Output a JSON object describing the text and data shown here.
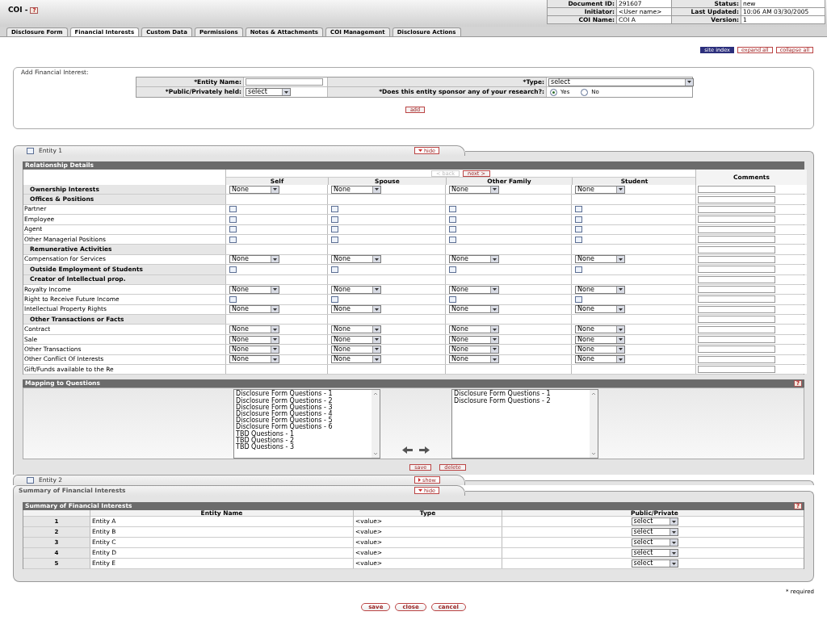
{
  "header": {
    "title": "COI -",
    "help": "?",
    "doc_info": [
      {
        "label": "Document ID:",
        "value": "291607"
      },
      {
        "label": "Status:",
        "value": "new"
      },
      {
        "label": "Initiator:",
        "value": "<User name>"
      },
      {
        "label": "Last Updated:",
        "value": "10:06 AM 03/30/2005"
      },
      {
        "label": "COI Name:",
        "value": "COI A"
      },
      {
        "label": "Version:",
        "value": "1"
      }
    ]
  },
  "tabs": [
    {
      "label": "Disclosure Form",
      "selected": false
    },
    {
      "label": "Financial Interests",
      "selected": true
    },
    {
      "label": "Custom Data",
      "selected": false
    },
    {
      "label": "Permissions",
      "selected": false
    },
    {
      "label": "Notes & Attachments",
      "selected": false
    },
    {
      "label": "COI Management",
      "selected": false
    },
    {
      "label": "Disclosure Actions",
      "selected": false
    }
  ],
  "toolbar": [
    {
      "label": "site index",
      "kind": "primary"
    },
    {
      "label": "expand all",
      "kind": "plain"
    },
    {
      "label": "collapse all",
      "kind": "plain"
    }
  ],
  "add_financial_interest": {
    "title": "Add Financial Interest:",
    "entity_name": {
      "label": "*Entity Name:"
    },
    "type": {
      "label": "*Type:",
      "value": "select"
    },
    "holding": {
      "label": "*Public/Privately held:",
      "value": "select"
    },
    "sponsor": {
      "label": "*Does this entity sponsor any of your research?:",
      "options": [
        {
          "label": "Yes",
          "selected": true
        },
        {
          "label": "No",
          "selected": false
        }
      ]
    },
    "button": "add"
  },
  "entities": [
    {
      "title": "Entity 1",
      "checked": false,
      "expanded": true,
      "toggle": "hide",
      "relationship_details": {
        "title": "Relationship Details",
        "pager": [
          {
            "label": "< back",
            "disabled": true
          },
          {
            "label": "next >",
            "disabled": false
          }
        ],
        "columns": [
          "Self",
          "Spouse",
          "Other Family",
          "Student"
        ],
        "comments_heading": "Comments",
        "rows": [
          {
            "label": "Ownership Interests",
            "heading": true,
            "kind": "select",
            "cells": [
              "None",
              "None",
              "None",
              "None"
            ]
          },
          {
            "label": "Offices & Positions",
            "heading": true,
            "kind": "none"
          },
          {
            "label": "Partner",
            "heading": false,
            "kind": "checkbox",
            "cells": [
              {
                "checked": false
              },
              {
                "checked": false
              },
              {
                "checked": false
              },
              {
                "checked": false
              }
            ]
          },
          {
            "label": "Employee",
            "heading": false,
            "kind": "checkbox",
            "cells": [
              {
                "checked": false
              },
              {
                "checked": false
              },
              {
                "checked": false
              },
              {
                "checked": false
              }
            ]
          },
          {
            "label": "Agent",
            "heading": false,
            "kind": "checkbox",
            "cells": [
              {
                "checked": false
              },
              {
                "checked": false
              },
              {
                "checked": false
              },
              {
                "checked": false
              }
            ]
          },
          {
            "label": "Other Managerial Positions",
            "heading": false,
            "kind": "checkbox",
            "cells": [
              {
                "checked": false
              },
              {
                "checked": false
              },
              {
                "checked": false
              },
              {
                "checked": false
              }
            ]
          },
          {
            "label": "Remunerative Activities",
            "heading": true,
            "kind": "none"
          },
          {
            "label": "Compensation for Services",
            "heading": false,
            "kind": "select",
            "cells": [
              "None",
              "None",
              "None",
              "None"
            ]
          },
          {
            "label": "Outside Employment of Students",
            "heading": true,
            "kind": "checkbox",
            "cells": [
              {
                "checked": false
              },
              {
                "checked": false
              },
              {
                "checked": false
              },
              {
                "checked": false
              }
            ]
          },
          {
            "label": "Creator of Intellectual prop.",
            "heading": true,
            "kind": "none"
          },
          {
            "label": "Royalty Income",
            "heading": false,
            "kind": "select",
            "cells": [
              "None",
              "None",
              "None",
              "None"
            ]
          },
          {
            "label": "Right to Receive Future Income",
            "heading": false,
            "kind": "checkbox",
            "cells": [
              {
                "checked": false
              },
              {
                "checked": false
              },
              {
                "checked": false
              },
              {
                "checked": false
              }
            ]
          },
          {
            "label": "Intellectual Property Rights",
            "heading": false,
            "kind": "select",
            "cells": [
              "None",
              "None",
              "None",
              "None"
            ]
          },
          {
            "label": "Other Transactions or Facts",
            "heading": true,
            "kind": "none"
          },
          {
            "label": "Contract",
            "heading": false,
            "kind": "select",
            "cells": [
              "None",
              "None",
              "None",
              "None"
            ]
          },
          {
            "label": "Sale",
            "heading": false,
            "kind": "select",
            "cells": [
              "None",
              "None",
              "None",
              "None"
            ]
          },
          {
            "label": "Other Transactions",
            "heading": false,
            "kind": "select",
            "cells": [
              "None",
              "None",
              "None",
              "None"
            ]
          },
          {
            "label": "Other Conflict Of Interests",
            "heading": false,
            "kind": "select",
            "cells": [
              "None",
              "None",
              "None",
              "None"
            ]
          },
          {
            "label": "Gift/Funds available to the Re",
            "heading": false,
            "kind": "blank"
          }
        ]
      },
      "mapping": {
        "title": "Mapping to Questions",
        "help": "?",
        "available": [
          "Disclosure Form Questions - 1",
          "Disclosure Form Questions - 2",
          "Disclosure Form Questions - 3",
          "Disclosure Form Questions - 4",
          "Disclosure Form Questions - 5",
          "Disclosure Form Questions - 6",
          "TBD Questions - 1",
          "TBD Questions - 2",
          "TBD Questions - 3"
        ],
        "chosen": [
          "Disclosure Form Questions - 1",
          "Disclosure Form Questions - 2"
        ]
      },
      "buttons": [
        "save",
        "delete"
      ]
    },
    {
      "title": "Entity 2",
      "checked": false,
      "expanded": false,
      "toggle": "show"
    }
  ],
  "summary": {
    "title": "Summary of Financial Interests",
    "expanded": true,
    "toggle": "hide",
    "table_title": "Summary of Financial Interests",
    "help": "?",
    "columns": [
      "Entity Name",
      "Type",
      "Public/Private"
    ],
    "rows": [
      {
        "number": "1",
        "name": "Entity A",
        "type": "<value>",
        "public_private": "select"
      },
      {
        "number": "2",
        "name": "Entity B",
        "type": "<value>",
        "public_private": "select"
      },
      {
        "number": "3",
        "name": "Entity C",
        "type": "<value>",
        "public_private": "select"
      },
      {
        "number": "4",
        "name": "Entity D",
        "type": "<value>",
        "public_private": "select"
      },
      {
        "number": "5",
        "name": "Entity E",
        "type": "<value>",
        "public_private": "select"
      }
    ]
  },
  "footer": {
    "required_note": "* required",
    "buttons": [
      "save",
      "close",
      "cancel"
    ]
  }
}
